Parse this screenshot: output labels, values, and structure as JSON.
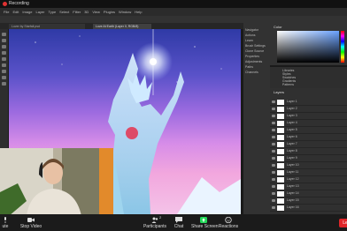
{
  "zoom": {
    "recording_label": "Recording",
    "bottom_bar": {
      "mute_label": "ute",
      "video_label": "Stop Video",
      "participants_label": "Participants",
      "participants_count": "2",
      "chat_label": "Chat",
      "share_label": "Share Screen",
      "reactions_label": "Reactions",
      "end_label": "Le"
    }
  },
  "photoshop": {
    "menu": [
      "File",
      "Edit",
      "Image",
      "Layer",
      "Type",
      "Select",
      "Filter",
      "3D",
      "View",
      "Plugins",
      "Window",
      "Help"
    ],
    "tabs": [
      "Lover by Starfall.psd",
      "Love At Earth (Layer 0, RGB/8)"
    ],
    "mid_panel": [
      "Navigator",
      "Actions",
      "Learn",
      "Brush Settings",
      "Clone Source",
      "Properties",
      "Adjustments",
      "Paths",
      "Channels"
    ],
    "color_panel_title": "Color",
    "library_items": [
      "Libraries",
      "Styles",
      "Swatches",
      "Gradients",
      "Patterns"
    ],
    "layers_panel_title": "Layers",
    "layers": [
      "Layer 1",
      "Layer 2",
      "Layer 3",
      "Layer 4",
      "Layer 5",
      "Layer 6",
      "Layer 7",
      "Layer 8",
      "Layer 9",
      "Layer 10",
      "Layer 11",
      "Layer 12",
      "Layer 13",
      "Layer 14",
      "Layer 15",
      "Layer 16"
    ]
  },
  "colors": {
    "accent_record": "#e03131",
    "end_button": "#e0262a",
    "share_green": "#23d959"
  }
}
